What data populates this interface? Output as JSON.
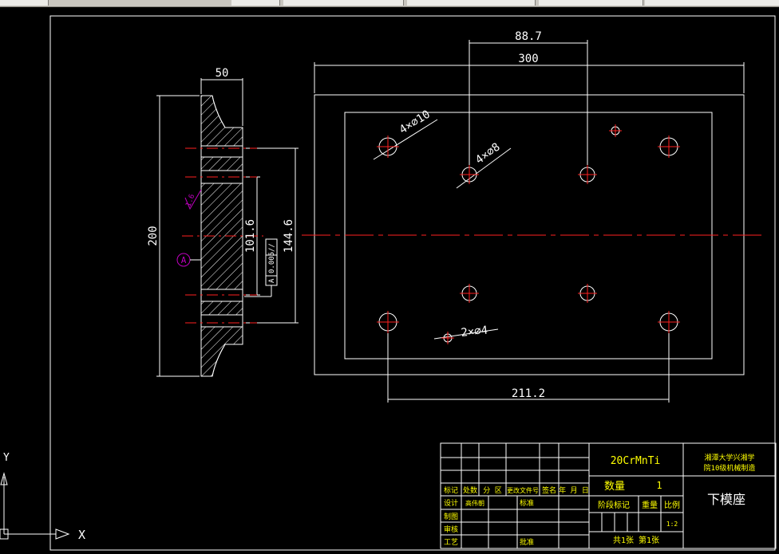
{
  "app": {
    "toolbar_colors": {
      "bar": "#c9c6bf",
      "segment": "#ecebe7"
    }
  },
  "drawing": {
    "colors": {
      "background": "#000000",
      "line": "#ffffff",
      "center": "#ff2020",
      "annotation": "#c000c0",
      "titletext": "#ffff00"
    },
    "dimensions": {
      "hole_spacing": "88.7",
      "plate_width": "300",
      "outer_hole_spacing": "211.2",
      "section_height": "200",
      "section_thickness": "50",
      "inner_height": "101.6",
      "pocket_height": "144.6"
    },
    "callouts": {
      "large_holes": "4×⌀10",
      "mid_holes": "4×⌀8",
      "small_holes": "2×⌀4",
      "roughness": "1.6",
      "datum": "A",
      "tolerance_symbol": "//",
      "tolerance_value": "0.005",
      "tolerance_datum": "A"
    }
  },
  "title_block": {
    "material": "20CrMnTi",
    "school_line1": "湘潭大学兴湘学",
    "school_line2": "院10级机械制造",
    "part_name": "下模座",
    "quantity_label": "数量",
    "quantity_value": "1",
    "stage_label": "阶段标记",
    "weight_label": "重量",
    "scale_label": "比例",
    "scale_value": "1:2",
    "sheets_text": "共1张  第1张",
    "rev_headers": [
      "标记",
      "处数",
      "分 区",
      "更改文件号",
      "签名",
      "年 月 日"
    ],
    "sign_rows": [
      {
        "label": "设计",
        "name": "高伟朝",
        "extra": "标准"
      },
      {
        "label": "制图",
        "name": "",
        "extra": ""
      },
      {
        "label": "审核",
        "name": "",
        "extra": ""
      },
      {
        "label": "工艺",
        "name": "",
        "extra": "批准"
      }
    ]
  },
  "ucs": {
    "y_label": "Y",
    "x_label": "X"
  }
}
